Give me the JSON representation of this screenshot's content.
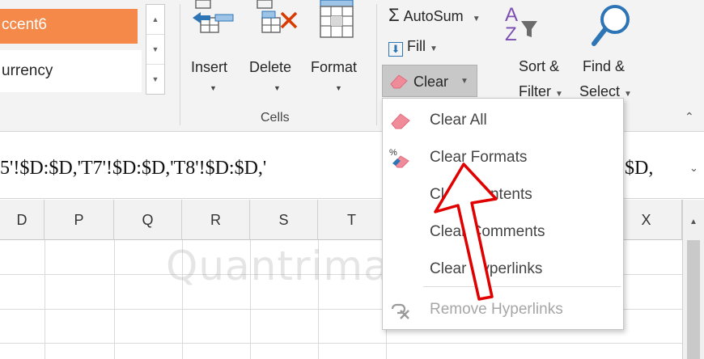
{
  "styles": {
    "accent_label": "ccent6",
    "currency_label": "urrency",
    "accent_color": "#f4894a"
  },
  "cells": {
    "group_label": "Cells",
    "insert_label": "Insert",
    "delete_label": "Delete",
    "format_label": "Format"
  },
  "editing": {
    "autosum_label": "AutoSum",
    "fill_label": "Fill",
    "clear_label": "Clear",
    "sort_label_1": "Sort &",
    "sort_label_2": "Filter",
    "find_label_1": "Find &",
    "find_label_2": "Select"
  },
  "formula_bar": {
    "text": "5'!$D:$D,'T7'!$D:$D,'T8'!$D:$D,'",
    "tail": "$D,"
  },
  "columns": [
    "D",
    "P",
    "Q",
    "R",
    "S",
    "T",
    "",
    "",
    "",
    "X"
  ],
  "clear_menu": {
    "items": [
      {
        "label": "Clear All",
        "icon": "eraser-icon",
        "disabled": false
      },
      {
        "label": "Clear Formats",
        "icon": "clear-formats-icon",
        "disabled": false
      },
      {
        "label": "Clear Contents",
        "icon": "",
        "disabled": false
      },
      {
        "label": "Clear Comments",
        "icon": "",
        "disabled": false
      },
      {
        "label": "Clear Hyperlinks",
        "icon": "",
        "disabled": false
      },
      {
        "label": "Remove Hyperlinks",
        "icon": "remove-link-icon",
        "disabled": true
      }
    ]
  },
  "watermark": "Quantrimang"
}
